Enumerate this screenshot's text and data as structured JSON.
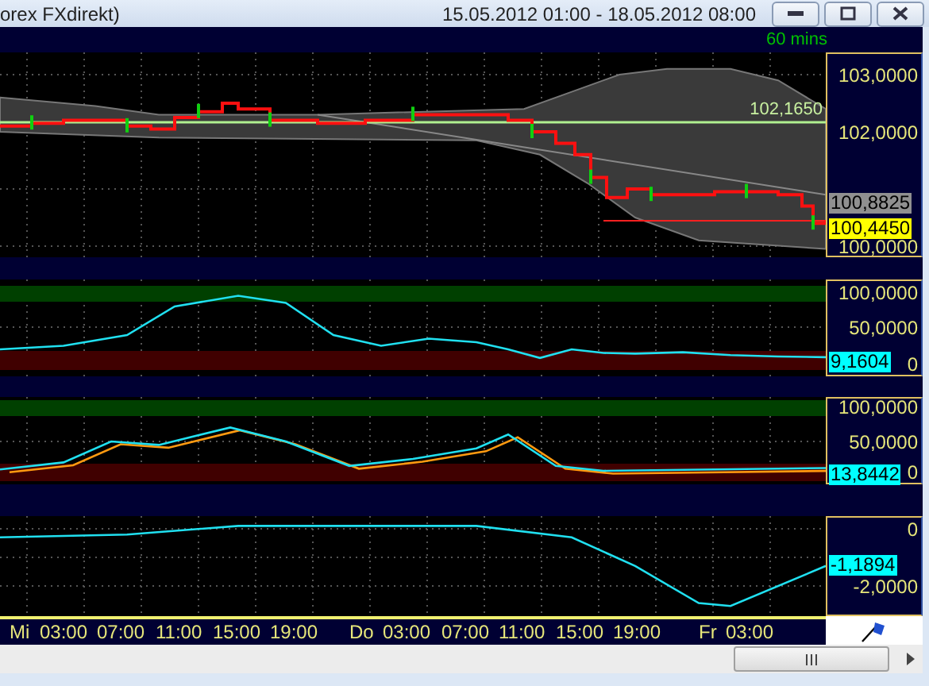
{
  "window": {
    "title": "orex FXdirekt)",
    "date_range": "15.05.2012 01:00 - 18.05.2012 08:00"
  },
  "timeframe": "60 mins",
  "panels": [
    {
      "kind": "price",
      "axis_labels": [
        "103,0000",
        "102,0000",
        "100,0000"
      ],
      "line_label": "102,1650",
      "markers": [
        {
          "text": "100,8825",
          "color": "#909090"
        },
        {
          "text": "100,4450",
          "color": "#ffff00"
        }
      ]
    },
    {
      "kind": "oscillator",
      "axis_labels": [
        "100,0000",
        "50,0000",
        "0"
      ],
      "markers": [
        {
          "text": "9,1604",
          "color": "#00ffff"
        }
      ]
    },
    {
      "kind": "dual",
      "axis_labels": [
        "100,0000",
        "50,0000",
        "0"
      ],
      "markers": [
        {
          "text": "13,8442",
          "color": "#00ffff"
        }
      ]
    },
    {
      "kind": "momentum",
      "axis_labels": [
        "0",
        "-2,0000"
      ],
      "markers": [
        {
          "text": "-1,1894",
          "color": "#00ffff"
        }
      ]
    }
  ],
  "time_axis": [
    "Mi",
    "03:00",
    "07:00",
    "11:00",
    "15:00",
    "19:00",
    "Do",
    "03:00",
    "07:00",
    "11:00",
    "15:00",
    "19:00",
    "Fr",
    "03:00"
  ]
}
